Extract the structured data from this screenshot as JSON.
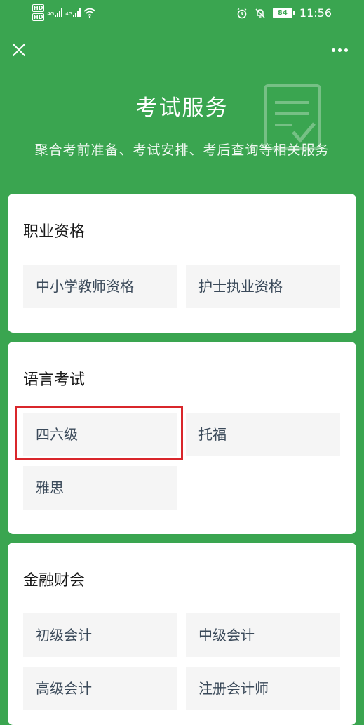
{
  "status_bar": {
    "hd1": "HD",
    "hd2": "HD",
    "net1": "4G",
    "net2": "4G",
    "battery": "84",
    "time": "11:56"
  },
  "header": {
    "title": "考试服务",
    "subtitle": "聚合考前准备、考试安排、考后查询等相关服务"
  },
  "sections": [
    {
      "title": "职业资格",
      "items": [
        "中小学教师资格",
        "护士执业资格"
      ]
    },
    {
      "title": "语言考试",
      "items": [
        "四六级",
        "托福",
        "雅思"
      ]
    },
    {
      "title": "金融财会",
      "items": [
        "初级会计",
        "中级会计",
        "高级会计",
        "注册会计师"
      ]
    }
  ],
  "colors": {
    "background": "#3aa550",
    "card": "#ffffff",
    "chip": "#f5f5f5",
    "highlight": "#d9262b"
  },
  "icons": {
    "close": "close-icon",
    "more": "more-icon",
    "document": "document-check-icon"
  }
}
